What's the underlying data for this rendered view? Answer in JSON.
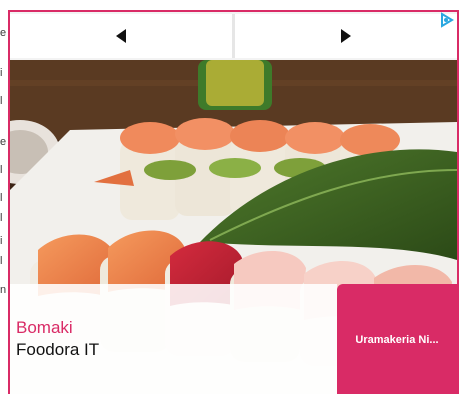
{
  "ad": {
    "nav": {
      "prev_icon": "triangle-left-icon",
      "next_icon": "triangle-right-icon"
    },
    "adchoices_icon": "adchoices-icon",
    "image_subject": "sushi-platter",
    "title": "Bomaki",
    "subtitle": "Foodora IT",
    "cta_label": "Uramakeria Ni...",
    "colors": {
      "accent": "#d92b66",
      "cta_text": "#ffffff",
      "title": "#d92b66",
      "subtitle": "#111111",
      "adchoices": "#2aa7e0"
    }
  },
  "left_gutter_chars": [
    "e",
    "i",
    "l",
    "e",
    "l",
    "l",
    "l",
    "i",
    "l",
    "n"
  ]
}
